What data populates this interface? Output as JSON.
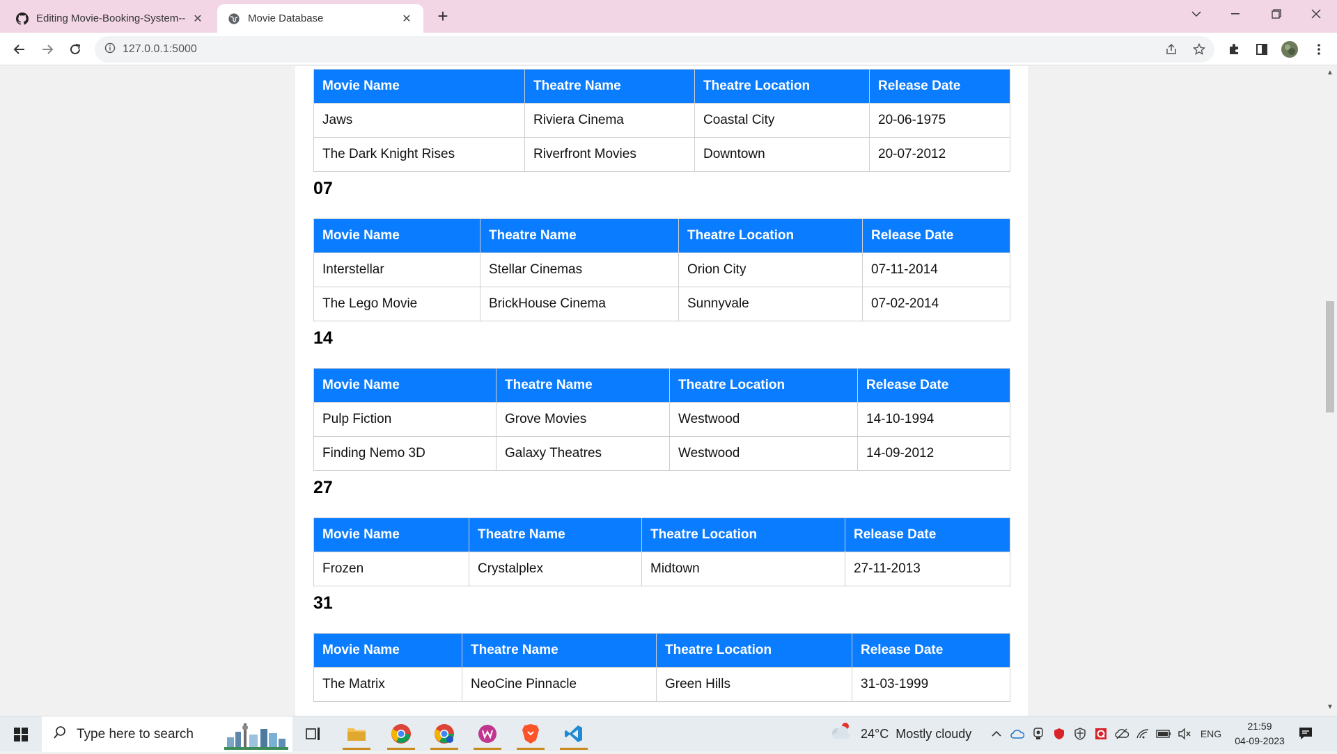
{
  "browser": {
    "tabs": [
      {
        "title": "Editing Movie-Booking-System--",
        "icon": "github-icon",
        "active": false
      },
      {
        "title": "Movie Database",
        "icon": "globe-icon",
        "active": true
      }
    ],
    "url": "127.0.0.1:5000"
  },
  "page": {
    "headers": [
      "Movie Name",
      "Theatre Name",
      "Theatre Location",
      "Release Date"
    ],
    "groups": [
      {
        "heading": "",
        "rows": [
          [
            "Jaws",
            "Riviera Cinema",
            "Coastal City",
            "20-06-1975"
          ],
          [
            "The Dark Knight Rises",
            "Riverfront Movies",
            "Downtown",
            "20-07-2012"
          ]
        ]
      },
      {
        "heading": "07",
        "rows": [
          [
            "Interstellar",
            "Stellar Cinemas",
            "Orion City",
            "07-11-2014"
          ],
          [
            "The Lego Movie",
            "BrickHouse Cinema",
            "Sunnyvale",
            "07-02-2014"
          ]
        ]
      },
      {
        "heading": "14",
        "rows": [
          [
            "Pulp Fiction",
            "Grove Movies",
            "Westwood",
            "14-10-1994"
          ],
          [
            "Finding Nemo 3D",
            "Galaxy Theatres",
            "Westwood",
            "14-09-2012"
          ]
        ]
      },
      {
        "heading": "27",
        "rows": [
          [
            "Frozen",
            "Crystalplex",
            "Midtown",
            "27-11-2013"
          ]
        ]
      },
      {
        "heading": "31",
        "rows": [
          [
            "The Matrix",
            "NeoCine Pinnacle",
            "Green Hills",
            "31-03-1999"
          ]
        ]
      }
    ]
  },
  "taskbar": {
    "search_placeholder": "Type here to search",
    "weather": {
      "temp": "24°C",
      "condition": "Mostly cloudy"
    },
    "language": "ENG",
    "time": "21:59",
    "date": "04-09-2023"
  },
  "colors": {
    "table_header_bg": "#0a7cff",
    "tab_strip_bg": "#f3d6e6"
  }
}
